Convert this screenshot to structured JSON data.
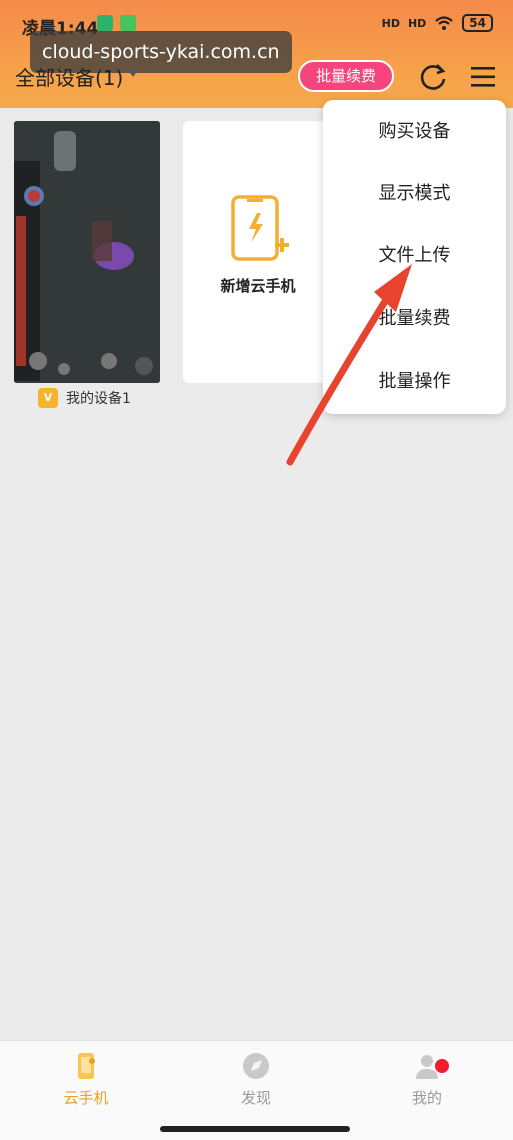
{
  "status_bar": {
    "time": "凌晨1:44",
    "network_labels": [
      "HD",
      "HD"
    ],
    "battery": "54"
  },
  "watermark": "cloud-sports-ykai.com.cn",
  "header": {
    "title": "全部设备(1)",
    "renew_button": "批量续费",
    "refresh_icon": "refresh-icon",
    "menu_icon": "hamburger-menu-icon"
  },
  "devices": [
    {
      "badge": "V",
      "name": "我的设备1"
    }
  ],
  "add_card": {
    "label": "新增云手机",
    "icon": "add-phone-icon"
  },
  "dropdown": {
    "items": [
      "购买设备",
      "显示模式",
      "文件上传",
      "批量续费",
      "批量操作"
    ]
  },
  "bottom_nav": {
    "items": [
      {
        "label": "云手机",
        "icon": "phone-icon",
        "active": true
      },
      {
        "label": "发现",
        "icon": "discover-icon",
        "active": false
      },
      {
        "label": "我的",
        "icon": "profile-icon",
        "active": false
      }
    ]
  },
  "colors": {
    "header_orange": "#f6a94a",
    "renew_pink": "#f5457c",
    "active_tab": "#e8a12a",
    "inactive_tab": "#999999",
    "arrow_red": "#e8432e"
  }
}
